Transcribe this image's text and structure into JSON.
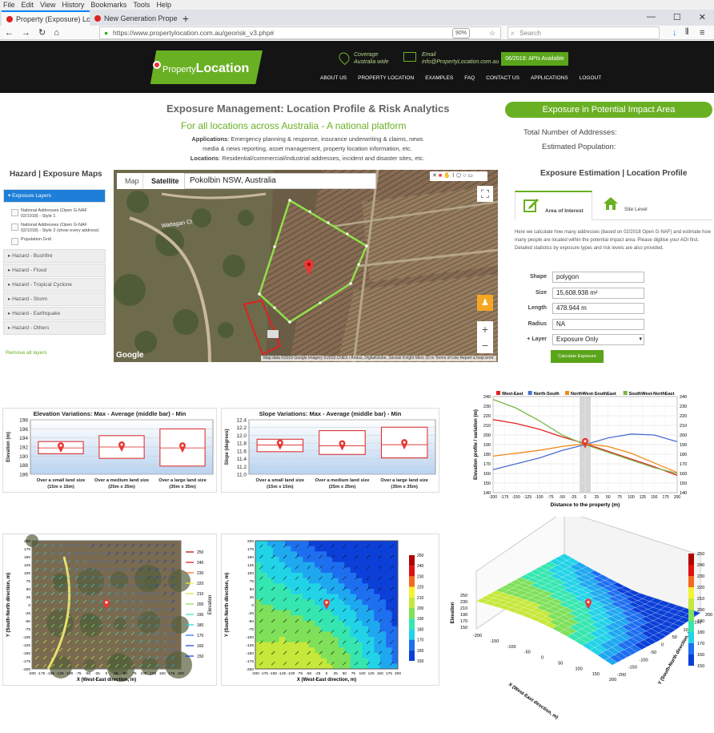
{
  "browser": {
    "menu": [
      "File",
      "Edit",
      "View",
      "History",
      "Bookmarks",
      "Tools",
      "Help"
    ],
    "tabs": [
      {
        "title": "Property (Exposure) Location R"
      },
      {
        "title": "New Generation Property Locati"
      }
    ],
    "url": "https://www.propertylocation.com.au/georisk_v3.php#",
    "zoom": "90%",
    "search_placeholder": "Search"
  },
  "header": {
    "logo_small": "Property",
    "logo_big": "Location",
    "coverage_l1": "Coverage",
    "coverage_l2": "Australia wide",
    "email_l1": "Email",
    "email_l2": "info@PropertyLocation.com.au",
    "api_btn": "06/2018: APIs Available",
    "nav": [
      "ABOUT US",
      "PROPERTY LOCATION",
      "EXAMPLES",
      "FAQ",
      "CONTACT US",
      "APPLICATIONS",
      "LOGOUT"
    ]
  },
  "intro": {
    "title": "Exposure Management: Location Profile & Risk Analytics",
    "subtitle": "For all locations across Australia - A national platform",
    "apps_label": "Applications",
    "apps_text": ": Emergency planning & response, insurance underwriting & claims, news media & news reporting, asset management, property location information, etc.",
    "loc_label": "Locations",
    "loc_text": ": Residential/commercial/industrial addresses, incident and disaster sites, etc."
  },
  "impact": {
    "button": "Exposure in Potential Impact Area",
    "total_label": "Total Number of Addresses:",
    "pop_label": "Estimated Population:"
  },
  "hazard": {
    "title": "Hazard | Exposure Maps",
    "open_section": "Exposure Layers",
    "items": [
      "National Addresses (Open G-NAF 02/1018) - Style 1",
      "National Addresses (Open G-NAF 02/1018) - Style 2 (show every address)",
      "Population Grid"
    ],
    "sections": [
      "Hazard - Bushfire",
      "Hazard - Flood",
      "Hazard - Tropical Cyclone",
      "Hazard - Storm",
      "Hazard - Earthquake",
      "Hazard - Others"
    ],
    "remove": "Remove all layers"
  },
  "map": {
    "tab_map": "Map",
    "tab_sat": "Satellite",
    "location": "Pokolbin NSW, Australia",
    "google": "Google",
    "attribution": "Map data ©2019 Google Imagery ©2019 CNES / Airbus, DigitalGlobe, Sinclair Knight Merz  20 m  Terms of Use  Report a map error",
    "road_label": "Wattagan Ct"
  },
  "estimation": {
    "title": "Exposure Estimation | Location Profile",
    "tab1": "Area of Interest",
    "tab2": "Site Level",
    "desc": "Here we calculate how many addresses (based on 02/2018 Open G-NAF) and estimate how many people are located within the potential impact area. Please digitise your AOI first. Detailed statistics by exposure types and risk levels are also provided.",
    "shape_l": "Shape",
    "shape_v": "polygon",
    "size_l": "Size",
    "size_v": "15,608.938 m²",
    "length_l": "Length",
    "length_v": "478.944 m",
    "radius_l": "Radius",
    "radius_v": "NA",
    "layer_l": "+ Layer",
    "layer_v": "Exposure Only",
    "calc": "Calculate Exposure"
  },
  "chart_data": [
    {
      "type": "box",
      "title": "Elevation Variations: Max - Average (middle bar) - Min",
      "ylabel": "Elevation (m)",
      "ylim": [
        186,
        198
      ],
      "yticks": [
        186,
        188,
        190,
        192,
        194,
        196,
        198
      ],
      "categories": [
        "Over a small land size (15m x 15m)",
        "Over a medium land size (25m x 25m)",
        "Over a large land size (35m x 35m)"
      ],
      "max": [
        193.2,
        194.5,
        196
      ],
      "avg": [
        191.8,
        192,
        191.8
      ],
      "min": [
        190.5,
        189.5,
        187.8
      ]
    },
    {
      "type": "box",
      "title": "Slope Variations: Max - Average (middle bar) - Min",
      "ylabel": "Slope (degrees)",
      "ylim": [
        11.0,
        12.4
      ],
      "yticks": [
        11.0,
        11.2,
        11.4,
        11.6,
        11.8,
        12.0,
        12.2,
        12.4
      ],
      "categories": [
        "Over a small land size (15m x 15m)",
        "Over a medium land size (25m x 25m)",
        "Over a large land size (35m x 35m)"
      ],
      "max": [
        11.9,
        12.12,
        12.21
      ],
      "avg": [
        11.75,
        11.73,
        11.76
      ],
      "min": [
        11.58,
        11.51,
        11.42
      ]
    },
    {
      "type": "line",
      "xlabel": "Distance to the property (m)",
      "ylabel": "Elevation profile / variation (m)",
      "ylim": [
        140,
        240
      ],
      "xticks": [
        -200,
        -175,
        -150,
        -125,
        -100,
        -75,
        -50,
        -25,
        0,
        25,
        50,
        75,
        100,
        125,
        150,
        175,
        200
      ],
      "yticks": [
        140,
        150,
        160,
        170,
        180,
        190,
        200,
        210,
        220,
        230,
        240
      ],
      "x": [
        -200,
        -150,
        -100,
        -50,
        0,
        50,
        100,
        150,
        200
      ],
      "series": [
        {
          "name": "West-East",
          "color": "#e32222",
          "values": [
            216,
            212,
            206,
            198,
            191,
            183,
            175,
            167,
            158
          ]
        },
        {
          "name": "North-South",
          "color": "#4a6fd0",
          "values": [
            164,
            170,
            176,
            184,
            190,
            197,
            201,
            200,
            193
          ]
        },
        {
          "name": "NorthWest-SouthEast",
          "color": "#f08a1c",
          "values": [
            178,
            181,
            184,
            188,
            191,
            188,
            181,
            171,
            161
          ]
        },
        {
          "name": "SouthWest-NorthEast",
          "color": "#7ab648",
          "values": [
            237,
            228,
            215,
            200,
            190,
            182,
            174,
            166,
            160
          ]
        }
      ]
    },
    {
      "type": "contour",
      "xlabel": "X (West-East direction, m)",
      "ylabel": "Y (South-North direction, m)",
      "legend_title": "Elevation",
      "ticks": [
        -200,
        -175,
        -150,
        -125,
        -100,
        -75,
        -50,
        -25,
        0,
        25,
        50,
        75,
        100,
        125,
        150,
        175,
        200
      ],
      "levels": [
        250,
        240,
        230,
        220,
        210,
        200,
        190,
        180,
        170,
        160,
        150
      ]
    },
    {
      "type": "heatmap",
      "xlabel": "X (West-East direction, m)",
      "ylabel": "Y (South-North direction, m)",
      "ticks": [
        -200,
        -175,
        -150,
        -125,
        -100,
        -75,
        -50,
        -25,
        0,
        25,
        50,
        75,
        100,
        125,
        150,
        175,
        200
      ],
      "levels": [
        250,
        240,
        230,
        220,
        210,
        200,
        190,
        180,
        170,
        160,
        150
      ]
    },
    {
      "type": "surface",
      "xlabel": "X (West-East direction, m)",
      "ylabel": "Y (South-North direction, m)",
      "zlabel": "Elevation",
      "xticks": [
        -200,
        -150,
        -100,
        -50,
        0,
        50,
        100,
        150,
        200
      ],
      "levels": [
        250,
        240,
        230,
        220,
        210,
        200,
        190,
        180,
        170,
        160,
        150
      ],
      "ztick_labels": [
        "250",
        "230",
        "210",
        "190",
        "170",
        "150"
      ]
    }
  ],
  "colors": {
    "brand_green": "#6ab023",
    "dark": "#141414",
    "blue": "#1e7fd8"
  }
}
